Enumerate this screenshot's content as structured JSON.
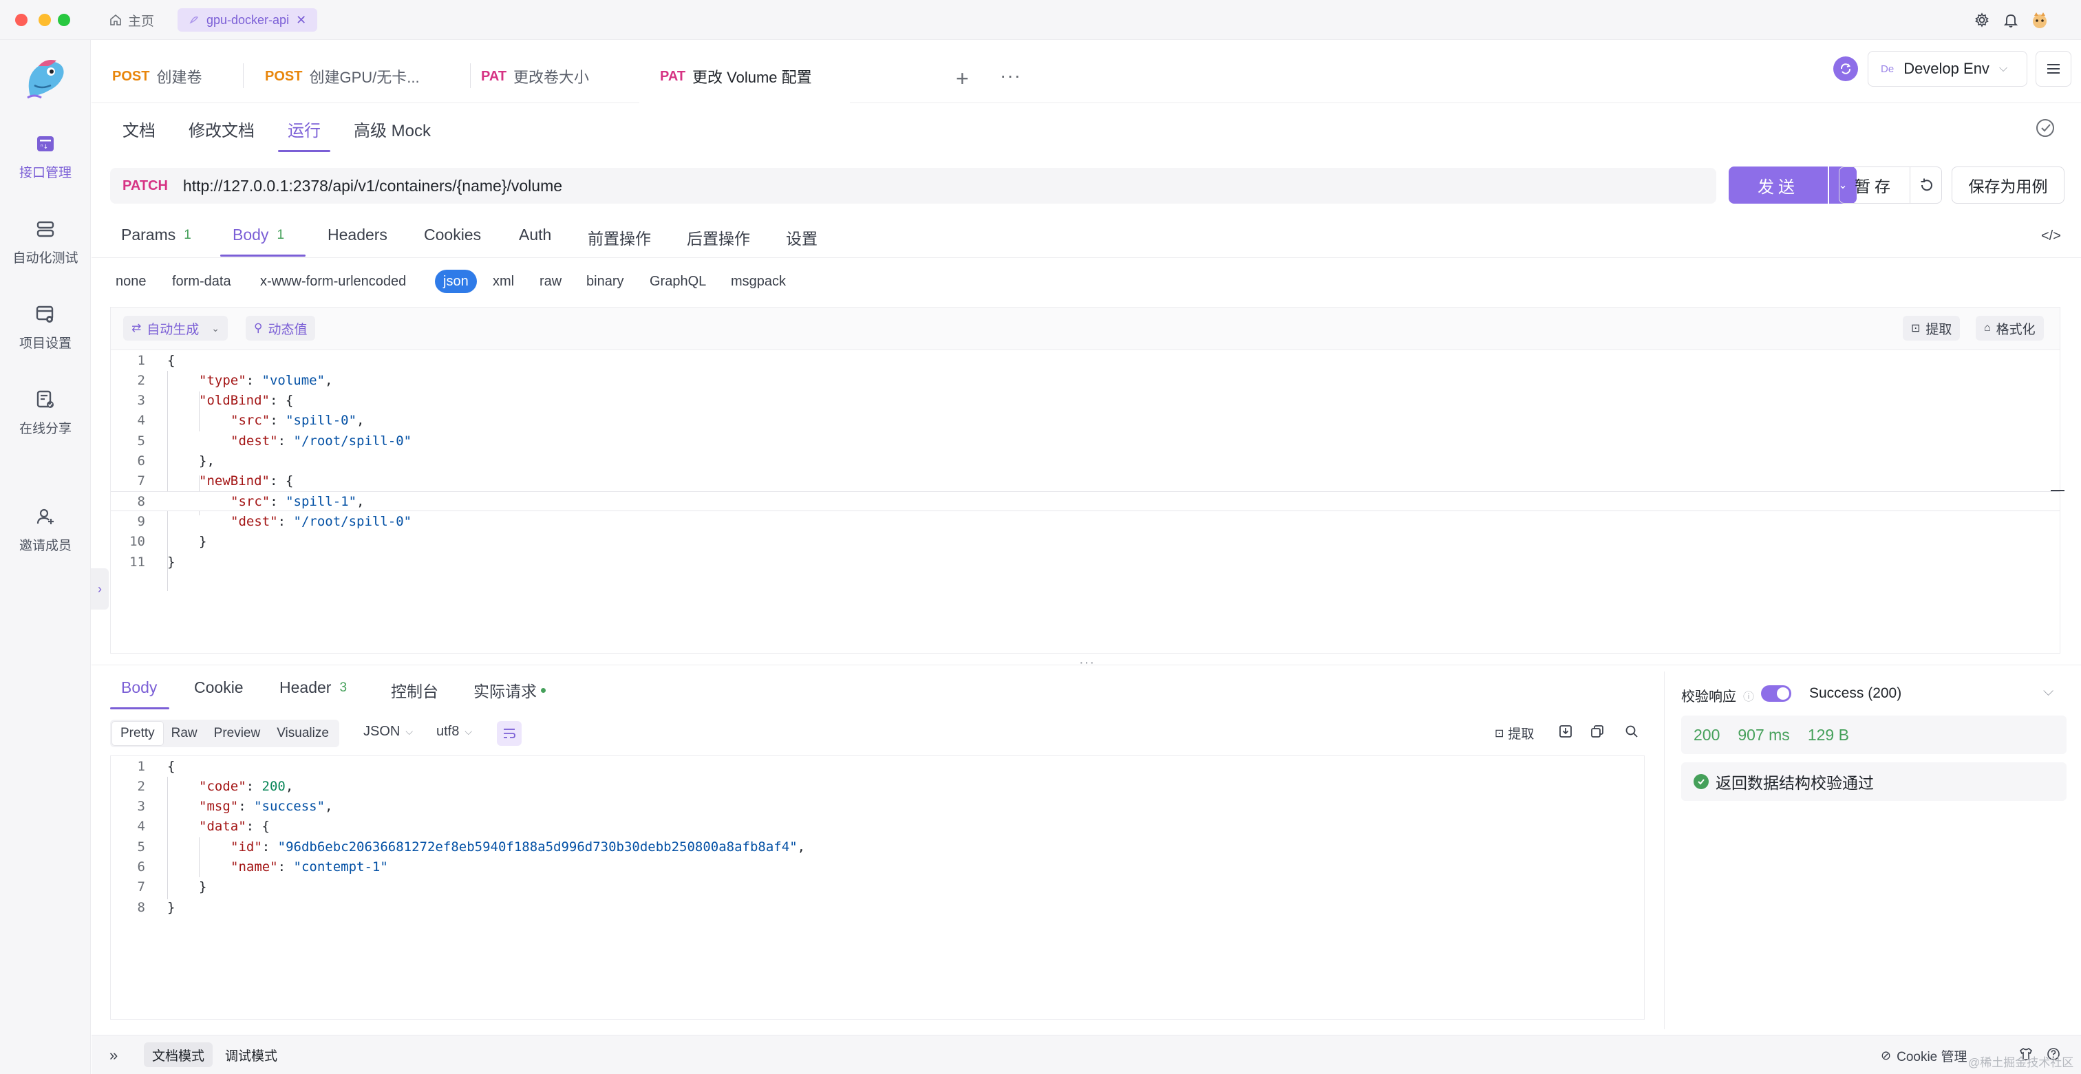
{
  "window": {
    "home_label": "主页",
    "project_tab": "gpu-docker-api"
  },
  "sidebar": {
    "items": [
      {
        "label": "接口管理",
        "icon": "api-management-icon",
        "active": true
      },
      {
        "label": "自动化测试",
        "icon": "automated-test-icon",
        "active": false
      },
      {
        "label": "项目设置",
        "icon": "project-settings-icon",
        "active": false
      },
      {
        "label": "在线分享",
        "icon": "online-share-icon",
        "active": false
      },
      {
        "label": "邀请成员",
        "icon": "invite-member-icon",
        "active": false
      }
    ]
  },
  "request_tabs": [
    {
      "method": "POST",
      "method_color": "#e8860c",
      "name": "创建卷"
    },
    {
      "method": "POST",
      "method_color": "#e8860c",
      "name": "创建GPU/无卡..."
    },
    {
      "method": "PAT",
      "method_color": "#d63384",
      "name": "更改卷大小"
    },
    {
      "method": "PAT",
      "method_color": "#d63384",
      "name": "更改 Volume 配置",
      "active": true
    }
  ],
  "environment": {
    "badge": "De",
    "name": "Develop Env"
  },
  "sub_tabs": [
    "文档",
    "修改文档",
    "运行",
    "高级 Mock"
  ],
  "url_bar": {
    "method": "PATCH",
    "url": "http://127.0.0.1:2378/api/v1/containers/{name}/volume",
    "send_label": "发送",
    "draft_label": "暂存",
    "save_case_label": "保存为用例"
  },
  "param_tabs": [
    {
      "label": "Params",
      "count": "1"
    },
    {
      "label": "Body",
      "count": "1",
      "active": true
    },
    {
      "label": "Headers",
      "count": ""
    },
    {
      "label": "Cookies",
      "count": ""
    },
    {
      "label": "Auth",
      "count": ""
    },
    {
      "label": "前置操作",
      "count": ""
    },
    {
      "label": "后置操作",
      "count": ""
    },
    {
      "label": "设置",
      "count": ""
    }
  ],
  "code_toggle": "</>",
  "body_types": [
    "none",
    "form-data",
    "x-www-form-urlencoded",
    "json",
    "xml",
    "raw",
    "binary",
    "GraphQL",
    "msgpack"
  ],
  "editor_toolbar": {
    "auto_generate": "自动生成",
    "dynamic_value": "动态值",
    "extract": "提取",
    "format": "格式化"
  },
  "request_body_lines": [
    {
      "n": "1",
      "indent": 0,
      "parts": [
        {
          "t": "{",
          "c": "p"
        }
      ]
    },
    {
      "n": "2",
      "indent": 1,
      "parts": [
        {
          "t": "\"type\"",
          "c": "k"
        },
        {
          "t": ": ",
          "c": "p"
        },
        {
          "t": "\"volume\"",
          "c": "s"
        },
        {
          "t": ",",
          "c": "p"
        }
      ]
    },
    {
      "n": "3",
      "indent": 1,
      "parts": [
        {
          "t": "\"oldBind\"",
          "c": "k"
        },
        {
          "t": ": {",
          "c": "p"
        }
      ]
    },
    {
      "n": "4",
      "indent": 2,
      "parts": [
        {
          "t": "\"src\"",
          "c": "k"
        },
        {
          "t": ": ",
          "c": "p"
        },
        {
          "t": "\"spill-0\"",
          "c": "s"
        },
        {
          "t": ",",
          "c": "p"
        }
      ]
    },
    {
      "n": "5",
      "indent": 2,
      "parts": [
        {
          "t": "\"dest\"",
          "c": "k"
        },
        {
          "t": ": ",
          "c": "p"
        },
        {
          "t": "\"/root/spill-0\"",
          "c": "s"
        }
      ]
    },
    {
      "n": "6",
      "indent": 1,
      "parts": [
        {
          "t": "},",
          "c": "p"
        }
      ]
    },
    {
      "n": "7",
      "indent": 1,
      "parts": [
        {
          "t": "\"newBind\"",
          "c": "k"
        },
        {
          "t": ": {",
          "c": "p"
        }
      ]
    },
    {
      "n": "8",
      "indent": 2,
      "parts": [
        {
          "t": "\"src\"",
          "c": "k"
        },
        {
          "t": ": ",
          "c": "p"
        },
        {
          "t": "\"spill-1\"",
          "c": "s"
        },
        {
          "t": ",",
          "c": "p"
        }
      ]
    },
    {
      "n": "9",
      "indent": 2,
      "parts": [
        {
          "t": "\"dest\"",
          "c": "k"
        },
        {
          "t": ": ",
          "c": "p"
        },
        {
          "t": "\"/root/spill-0\"",
          "c": "s"
        }
      ]
    },
    {
      "n": "10",
      "indent": 1,
      "parts": [
        {
          "t": "}",
          "c": "p"
        }
      ]
    },
    {
      "n": "11",
      "indent": 0,
      "parts": [
        {
          "t": "}",
          "c": "p"
        }
      ]
    }
  ],
  "response_tabs": [
    {
      "label": "Body",
      "count": "",
      "active": true
    },
    {
      "label": "Cookie",
      "count": ""
    },
    {
      "label": "Header",
      "count": "3"
    },
    {
      "label": "控制台",
      "count": ""
    },
    {
      "label": "实际请求",
      "count": "",
      "dot": true
    }
  ],
  "response_view": {
    "modes": [
      "Pretty",
      "Raw",
      "Preview",
      "Visualize"
    ],
    "format": "JSON",
    "encoding": "utf8",
    "extract": "提取"
  },
  "response_body_lines": [
    {
      "n": "1",
      "indent": 0,
      "parts": [
        {
          "t": "{",
          "c": "p"
        }
      ]
    },
    {
      "n": "2",
      "indent": 1,
      "parts": [
        {
          "t": "\"code\"",
          "c": "k"
        },
        {
          "t": ": ",
          "c": "p"
        },
        {
          "t": "200",
          "c": "num"
        },
        {
          "t": ",",
          "c": "p"
        }
      ]
    },
    {
      "n": "3",
      "indent": 1,
      "parts": [
        {
          "t": "\"msg\"",
          "c": "k"
        },
        {
          "t": ": ",
          "c": "p"
        },
        {
          "t": "\"success\"",
          "c": "s"
        },
        {
          "t": ",",
          "c": "p"
        }
      ]
    },
    {
      "n": "4",
      "indent": 1,
      "parts": [
        {
          "t": "\"data\"",
          "c": "k"
        },
        {
          "t": ": {",
          "c": "p"
        }
      ]
    },
    {
      "n": "5",
      "indent": 2,
      "parts": [
        {
          "t": "\"id\"",
          "c": "k"
        },
        {
          "t": ": ",
          "c": "p"
        },
        {
          "t": "\"96db6ebc20636681272ef8eb5940f188a5d996d730b30debb250800a8afb8af4\"",
          "c": "s"
        },
        {
          "t": ",",
          "c": "p"
        }
      ]
    },
    {
      "n": "6",
      "indent": 2,
      "parts": [
        {
          "t": "\"name\"",
          "c": "k"
        },
        {
          "t": ": ",
          "c": "p"
        },
        {
          "t": "\"contempt-1\"",
          "c": "s"
        }
      ]
    },
    {
      "n": "7",
      "indent": 1,
      "parts": [
        {
          "t": "}",
          "c": "p"
        }
      ]
    },
    {
      "n": "8",
      "indent": 0,
      "parts": [
        {
          "t": "}",
          "c": "p"
        }
      ]
    }
  ],
  "validation": {
    "title": "校验响应",
    "status": "Success (200)",
    "code": "200",
    "time": "907 ms",
    "size": "129 B",
    "pass_message": "返回数据结构校验通过"
  },
  "footer": {
    "doc_mode": "文档模式",
    "debug_mode": "调试模式",
    "cookie_manage": "Cookie 管理",
    "watermark": "@稀土掘金技术社区"
  },
  "colors": {
    "accent": "#7b5fd6",
    "send": "#8d6ee8",
    "patch": "#d63384",
    "post": "#e8860c",
    "success": "#45a05a",
    "json_active": "#2f7be8"
  }
}
